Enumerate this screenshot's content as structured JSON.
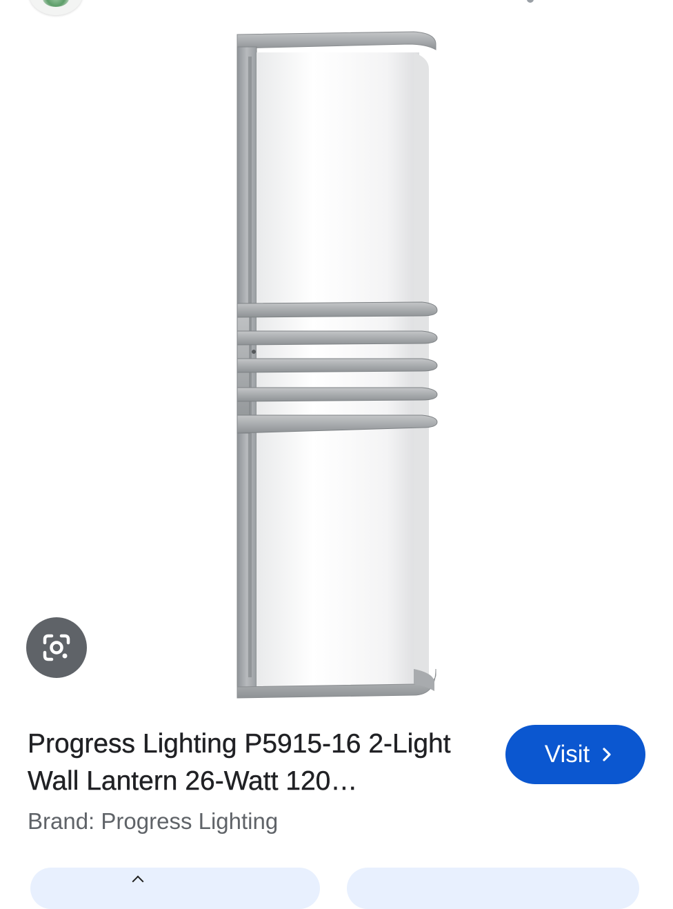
{
  "product": {
    "title": "Progress Lighting P5915-16 2-Light Wall Lantern 26-Watt 120…",
    "brand_line": "Brand: Progress Lighting",
    "image_subject": "wall-lantern-photo"
  },
  "actions": {
    "visit_label": "Visit",
    "visit_icon": "chevron-right-icon",
    "lens_icon": "google-lens-icon"
  },
  "colors": {
    "visit_button": "#0b57d0",
    "lens_button": "#5f6368",
    "brand_text": "#5f6368",
    "chip_background": "#e8f0fe"
  }
}
